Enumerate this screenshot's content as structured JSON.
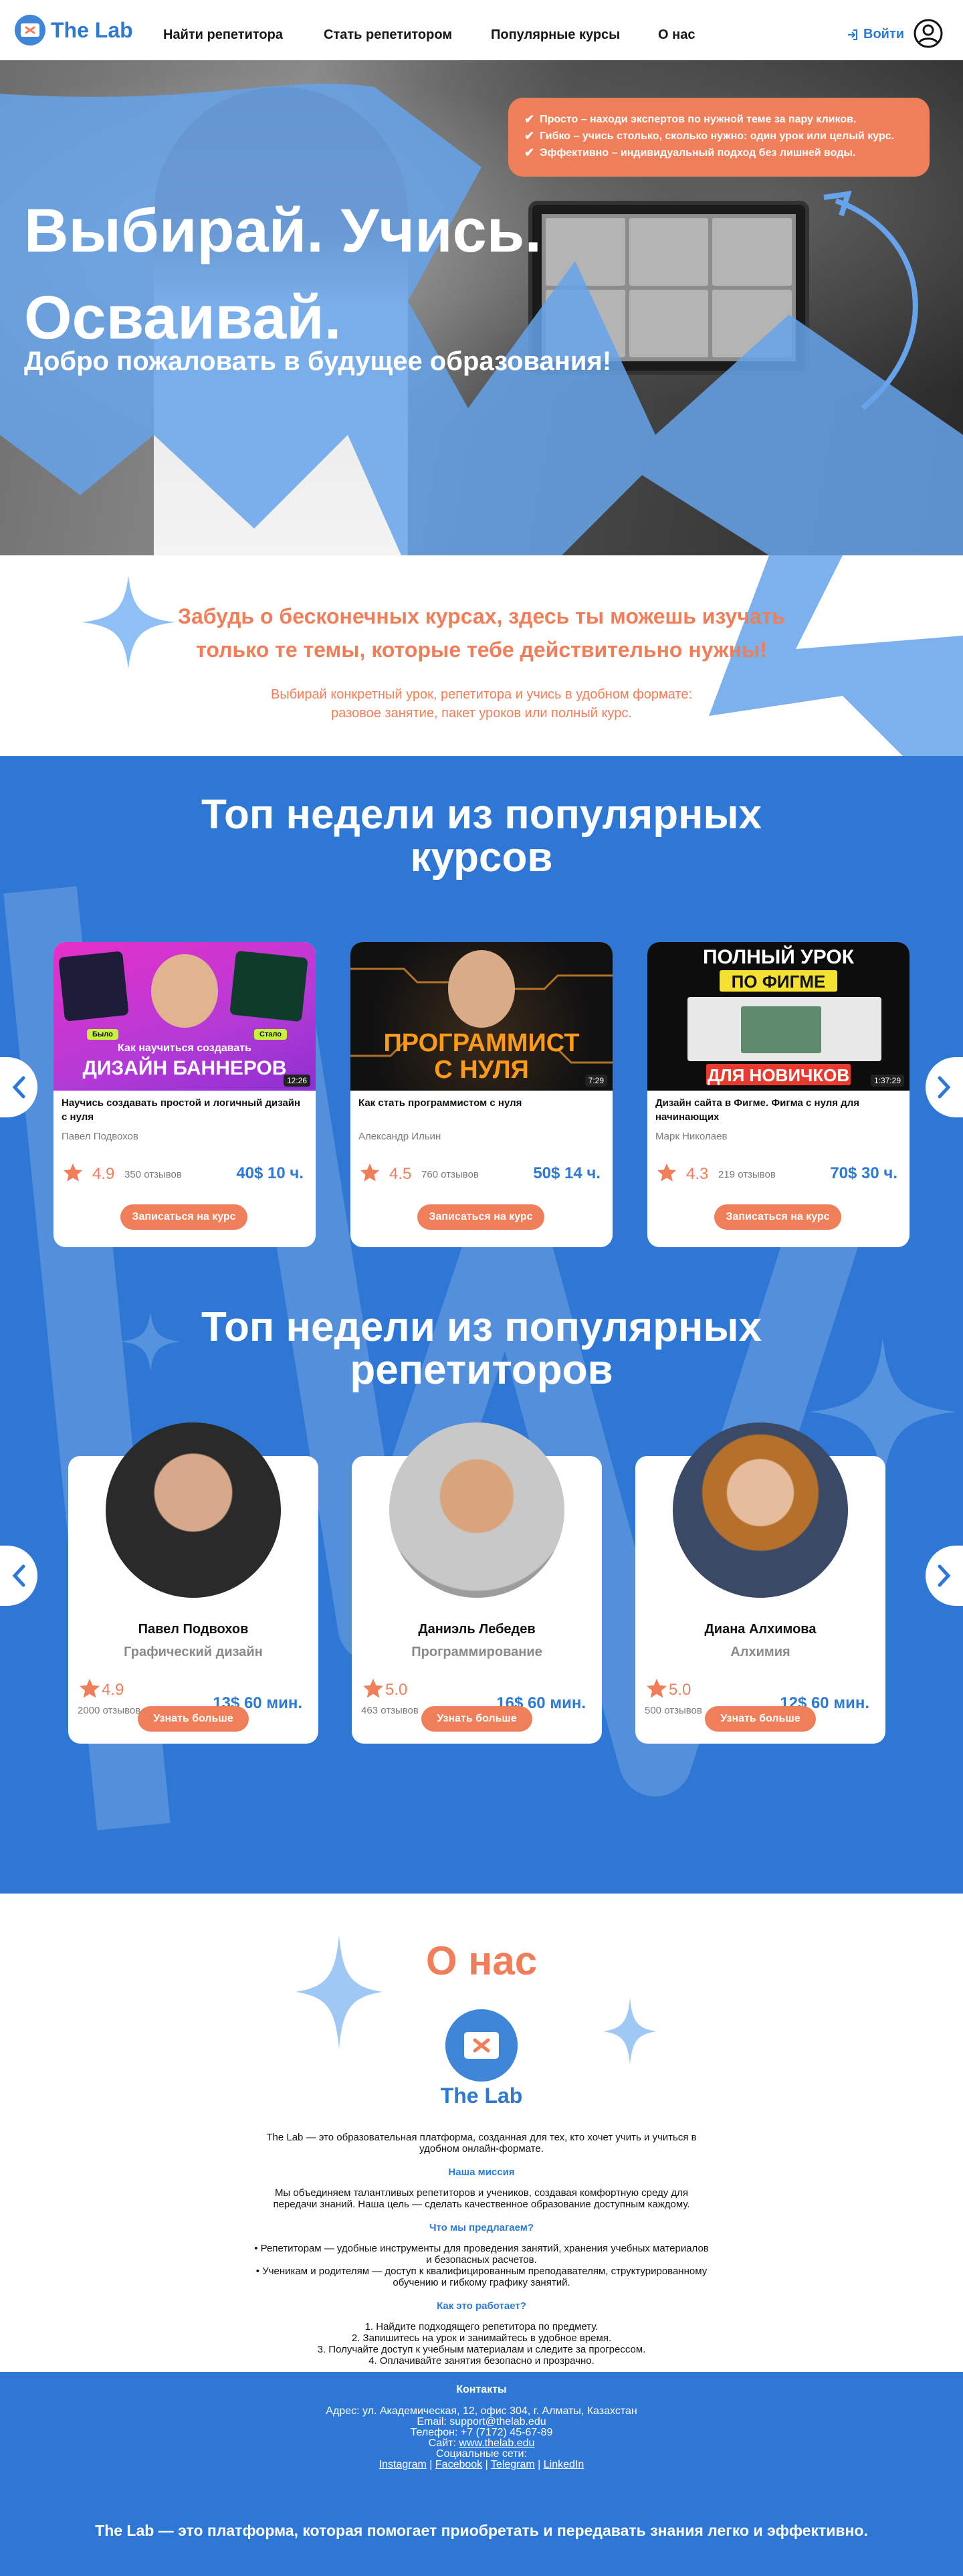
{
  "header": {
    "logo_text": "The Lab",
    "nav": [
      "Найти репетитора",
      "Стать репетитором",
      "Популярные курсы",
      "О нас"
    ],
    "login_label": "Войти"
  },
  "hero": {
    "title_line1": "Выбирай. Учись.",
    "title_line2": "Осваивай.",
    "subtitle": "Добро пожаловать в будущее образования!",
    "bullets": [
      "Просто – находи экспертов по нужной теме за пару кликов.",
      "Гибко – учись столько, сколько нужно: один урок или целый курс.",
      "Эффективно – индивидуальный подход без лишней воды."
    ]
  },
  "intro": {
    "headline_line1": "Забудь о бесконечных курсах, здесь ты можешь изучать",
    "headline_line2": "только те темы, которые тебе действительно нужны!",
    "text_line1": "Выбирай конкретный урок, репетитора и учись в удобном формате:",
    "text_line2": "разовое занятие, пакет уроков или полный курс."
  },
  "courses_section": {
    "title_line1": "Топ недели из популярных",
    "title_line2": "курсов",
    "items": [
      {
        "thumb_top": "Как научиться создавать",
        "thumb_main": "ДИЗАЙН БАННЕРОВ",
        "thumb_tag1": "Было",
        "thumb_tag2": "Стало",
        "duration": "12:26",
        "title": "Научись создавать простой и логичный дизайн с нуля",
        "author": "Павел Подвохов",
        "rating": "4.9",
        "reviews": "350 отзывов",
        "price": "40$ 10 ч.",
        "button": "Записаться на курс"
      },
      {
        "thumb_main": "ПРОГРАММИСТ",
        "thumb_main2": "С НУЛЯ",
        "duration": "7:29",
        "title": "Как стать программистом с нуля",
        "author": "Александр Ильин",
        "rating": "4.5",
        "reviews": "760 отзывов",
        "price": "50$ 14 ч.",
        "button": "Записаться на курс"
      },
      {
        "thumb_top": "ПОЛНЫЙ УРОК",
        "thumb_mid": "ПО ФИГМЕ",
        "thumb_bottom": "ДЛЯ НОВИЧКОВ",
        "duration": "1:37:29",
        "title": "Дизайн сайта в Фигме. Фигма с нуля для начинающих",
        "author": "Марк Николаев",
        "rating": "4.3",
        "reviews": "219 отзывов",
        "price": "70$ 30 ч.",
        "button": "Записаться на курс"
      }
    ]
  },
  "tutors_section": {
    "title_line1": "Топ недели из популярных",
    "title_line2": "репетиторов",
    "items": [
      {
        "name": "Павел Подвохов",
        "subject": "Графический дизайн",
        "rating": "4.9",
        "reviews": "2000 отзывов",
        "price": "13$ 60 мин.",
        "button": "Узнать больше"
      },
      {
        "name": "Даниэль Лебедев",
        "subject": "Программирование",
        "rating": "5.0",
        "reviews": "463 отзывов",
        "price": "16$ 60 мин.",
        "button": "Узнать больше"
      },
      {
        "name": "Диана Алхимова",
        "subject": "Алхимия",
        "rating": "5.0",
        "reviews": "500 отзывов",
        "price": "12$ 60 мин.",
        "button": "Узнать больше"
      }
    ]
  },
  "about": {
    "title": "О нас",
    "name": "The Lab",
    "p1_line1": "The Lab — это образовательная платформа, созданная для тех, кто хочет учить и учиться в",
    "p1_line2": "удобном онлайн-формате.",
    "h_mission": "Наша миссия",
    "mission_line1": "Мы объединяем талантливых репетиторов и учеников, создавая комфортную среду для",
    "mission_line2": "передачи знаний. Наша цель — сделать качественное образование доступным каждому.",
    "h_offer": "Что мы предлагаем?",
    "offer1_line1": "• Репетиторам — удобные инструменты для проведения занятий, хранения учебных материалов",
    "offer1_line2": "и безопасных расчетов.",
    "offer2_line1": "• Ученикам и родителям — доступ к квалифицированным преподавателям, структурированному",
    "offer2_line2": "обучению и гибкому графику занятий.",
    "h_how": "Как это работает?",
    "steps": [
      "1. Найдите подходящего репетитора по предмету.",
      "2. Запишитесь на урок и занимайтесь в удобное время.",
      "3. Получайте доступ к учебным материалам и следите за прогрессом.",
      "4. Оплачивайте занятия безопасно и прозрачно."
    ]
  },
  "footer": {
    "heading": "Контакты",
    "address": "Адрес: ул. Академическая, 12, офис 304, г. Алматы, Казахстан",
    "email_label": "Email: ",
    "email": "support@thelab.edu",
    "phone": "Телефон: +7 (7172) 45-67-89",
    "site_label": "Сайт: ",
    "site": "www.thelab.edu",
    "social_label": "Социальные сети:",
    "socials": [
      "Instagram",
      "Facebook",
      "Telegram",
      "LinkedIn"
    ],
    "slogan": "The Lab — это платформа, которая помогает приобретать и передавать знания легко и эффективно."
  },
  "colors": {
    "accent_blue": "#2e77d4",
    "accent_orange": "#ee7f5a",
    "star": "#ee7f5a"
  }
}
